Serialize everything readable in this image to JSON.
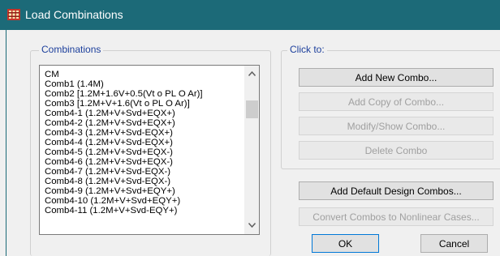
{
  "window": {
    "title": "Load Combinations"
  },
  "combinations": {
    "label": "Combinations",
    "items": [
      "CM",
      "Comb1 (1.4M)",
      "Comb2 [1.2M+1.6V+0.5(Vt o PL O Ar)]",
      "Comb3 [1.2M+V+1.6(Vt o PL O Ar)]",
      "Comb4-1 (1.2M+V+Svd+EQX+)",
      "Comb4-2 (1.2M+V+Svd+EQX+)",
      "Comb4-3 (1.2M+V+Svd-EQX+)",
      "Comb4-4 (1.2M+V+Svd-EQX+)",
      "Comb4-5 (1.2M+V+Svd+EQX-)",
      "Comb4-6 (1.2M+V+Svd+EQX-)",
      "Comb4-7 (1.2M+V+Svd-EQX-)",
      "Comb4-8 (1.2M+V+Svd-EQX-)",
      "Comb4-9 (1.2M+V+Svd+EQY+)",
      "Comb4-10  (1.2M+V+Svd+EQY+)",
      "Comb4-11  (1.2M+V+Svd-EQY+)"
    ]
  },
  "click_to": {
    "label": "Click to:",
    "add_new_combo": "Add New Combo...",
    "add_copy_of_combo": "Add Copy of Combo...",
    "modify_show_combo": "Modify/Show Combo...",
    "delete_combo": "Delete Combo"
  },
  "actions": {
    "add_default_design_combos": "Add Default Design Combos...",
    "convert_combos": "Convert Combos to Nonlinear Cases...",
    "ok": "OK",
    "cancel": "Cancel"
  },
  "colors": {
    "titlebar": "#1c6a78",
    "group_label": "#1c3f9c",
    "disabled_text": "#a0a0a0"
  },
  "icons": {
    "app_icon": "etabs-app-icon",
    "scroll_up": "chevron-up-icon",
    "scroll_down": "chevron-down-icon"
  }
}
